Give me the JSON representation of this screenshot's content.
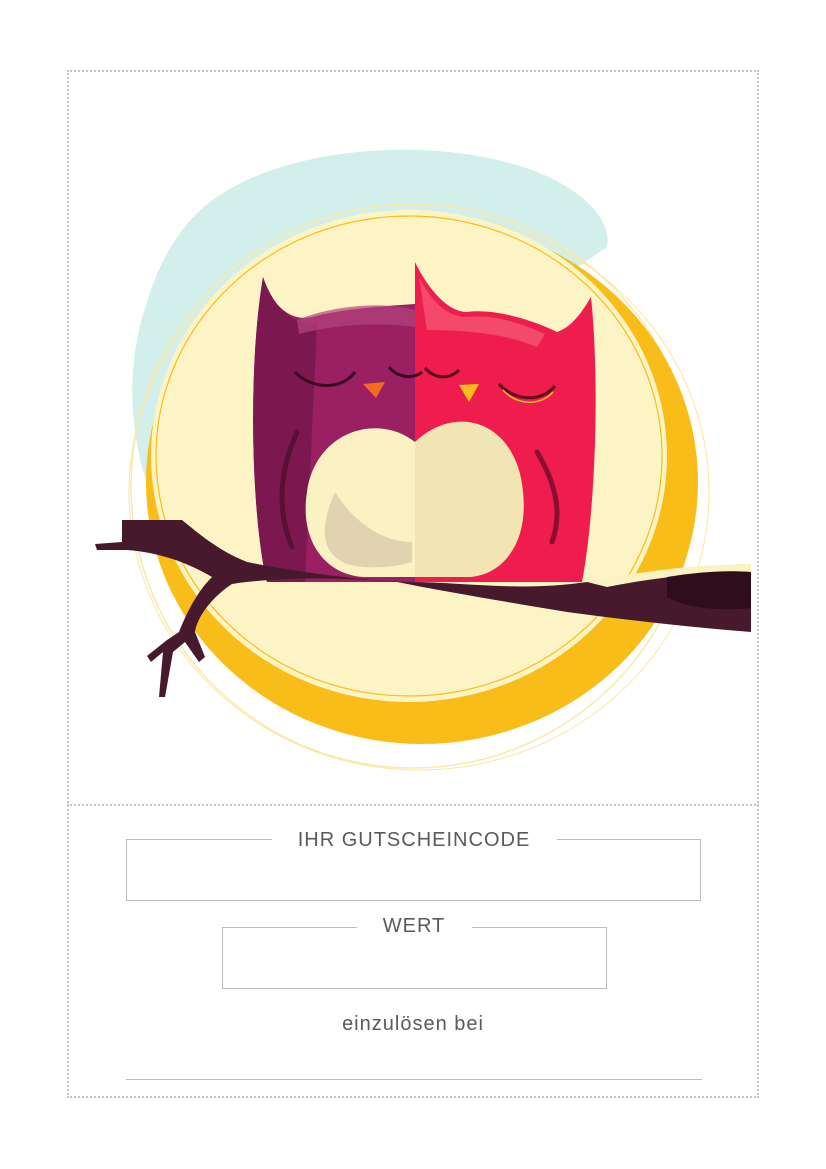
{
  "voucher": {
    "code_label": "IHR GUTSCHEINCODE",
    "code_value": "",
    "value_label": "WERT",
    "value_value": "",
    "redeem_text": "einzulösen bei"
  },
  "illustration": {
    "subject": "two owls on a branch in front of the moon",
    "colors": {
      "moon": "#fdf4c6",
      "moon_ring": "#f9bd1a",
      "sky_splash": "#d3efec",
      "owl_left": "#9a1f63",
      "owl_right": "#ee1d4d",
      "owl_belly": "#fbf2c3",
      "branch": "#461a2c"
    }
  }
}
